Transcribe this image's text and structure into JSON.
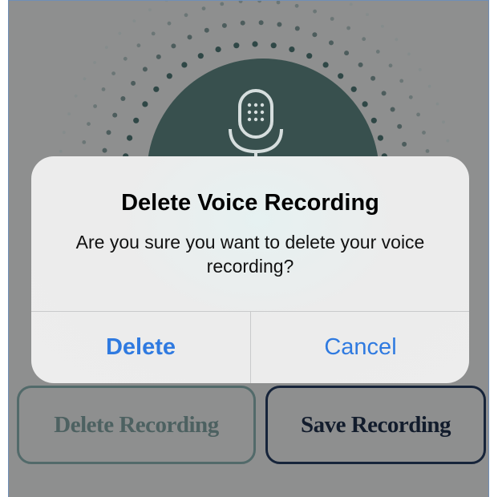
{
  "alert": {
    "title": "Delete Voice Recording",
    "message": "Are you sure you want to delete your voice recording?",
    "delete_label": "Delete",
    "cancel_label": "Cancel"
  },
  "actions": {
    "delete_recording_label": "Delete Recording",
    "save_recording_label": "Save Recording"
  },
  "recorder": {
    "icon": "microphone-icon"
  },
  "colors": {
    "overlay": "#8e8f8f",
    "mic_circle": "#38504e",
    "alert_bg": "#ededed",
    "alert_action": "#2f7ae0",
    "save_border": "#16243a",
    "delete_border": "#526a6a"
  }
}
